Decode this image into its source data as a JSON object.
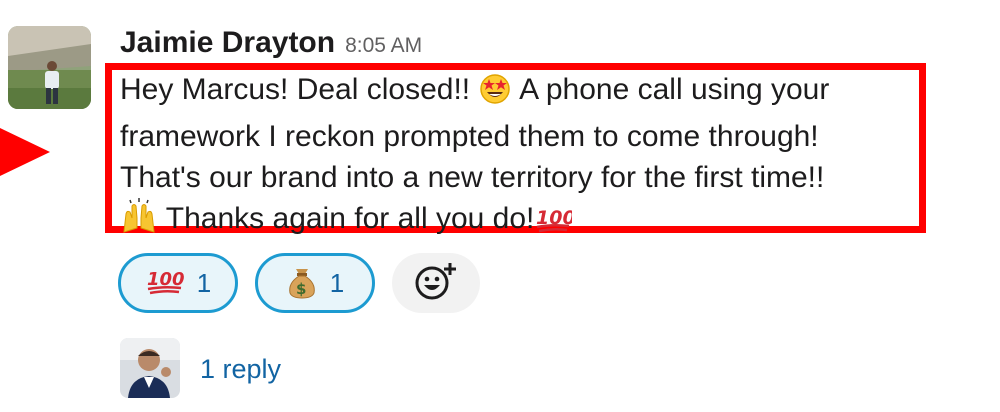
{
  "message": {
    "author": "Jaimie Drayton",
    "time": "8:05 AM",
    "lines": [
      {
        "parts": [
          "Hey Marcus! Deal closed!! ",
          " A phone call using your"
        ]
      },
      {
        "text": "framework I reckon prompted them to come through!"
      },
      {
        "text": "That's our brand into a new territory for the first time!!"
      },
      {
        "parts": [
          "  Thanks again for all you do!"
        ]
      }
    ]
  },
  "reactions": [
    {
      "emoji": "100-icon",
      "count": "1"
    },
    {
      "emoji": "money-bag-icon",
      "count": "1"
    }
  ],
  "thread": {
    "reply_label": "1 reply"
  },
  "colors": {
    "highlight": "#ff0000",
    "link": "#1264a3",
    "reaction_border": "#1d9bd1",
    "reaction_bg": "#e8f5fa"
  }
}
